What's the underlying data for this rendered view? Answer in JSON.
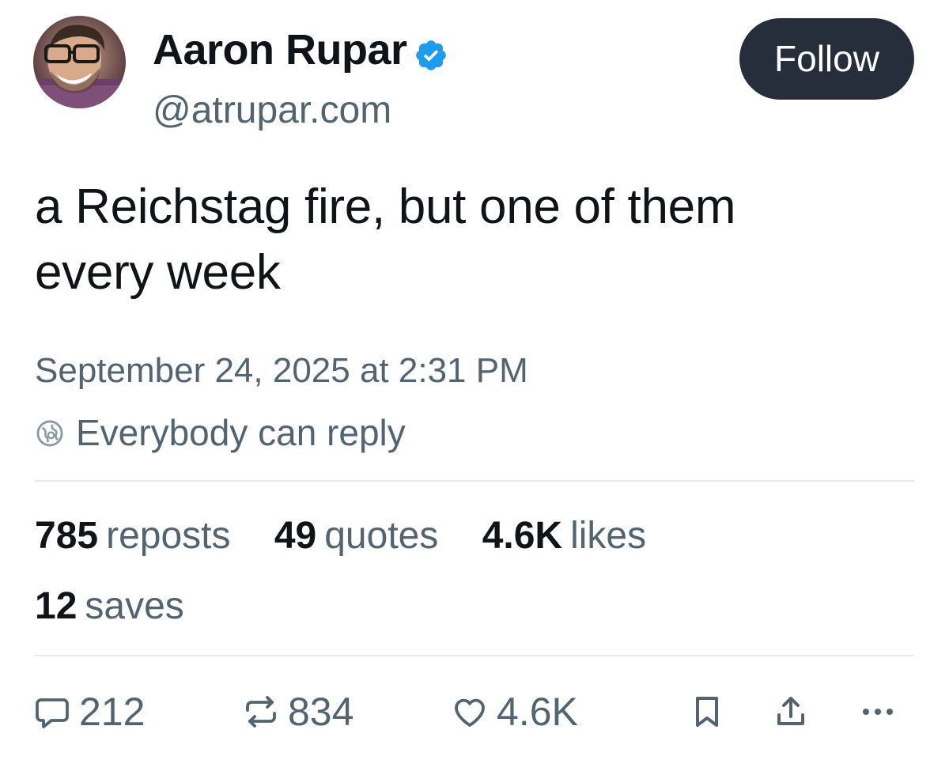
{
  "author": {
    "name": "Aaron Rupar",
    "handle": "@atrupar.com",
    "avatar_icon": "avatar-photo",
    "verified": true,
    "verified_color": "#1d9bf0"
  },
  "follow_button": {
    "label": "Follow"
  },
  "post": {
    "text_line1": "a Reichstag fire, but one of them",
    "text_line2": "every week"
  },
  "meta": {
    "timestamp": "September 24, 2025 at 2:31 PM",
    "reply_setting": "Everybody can reply",
    "reply_icon": "globe-icon"
  },
  "stats": {
    "reposts": {
      "count": "785",
      "label": "reposts"
    },
    "quotes": {
      "count": "49",
      "label": "quotes"
    },
    "likes": {
      "count": "4.6K",
      "label": "likes"
    },
    "saves": {
      "count": "12",
      "label": "saves"
    }
  },
  "actions": {
    "replies": "212",
    "reposts": "834",
    "likes": "4.6K",
    "icons": [
      "reply-icon",
      "repost-icon",
      "like-icon",
      "bookmark-icon",
      "share-icon",
      "more-icon"
    ]
  },
  "colors": {
    "text_primary": "#0f1419",
    "text_secondary": "#536471",
    "follow_bg": "#252e3a",
    "divider": "#e6eaed"
  }
}
